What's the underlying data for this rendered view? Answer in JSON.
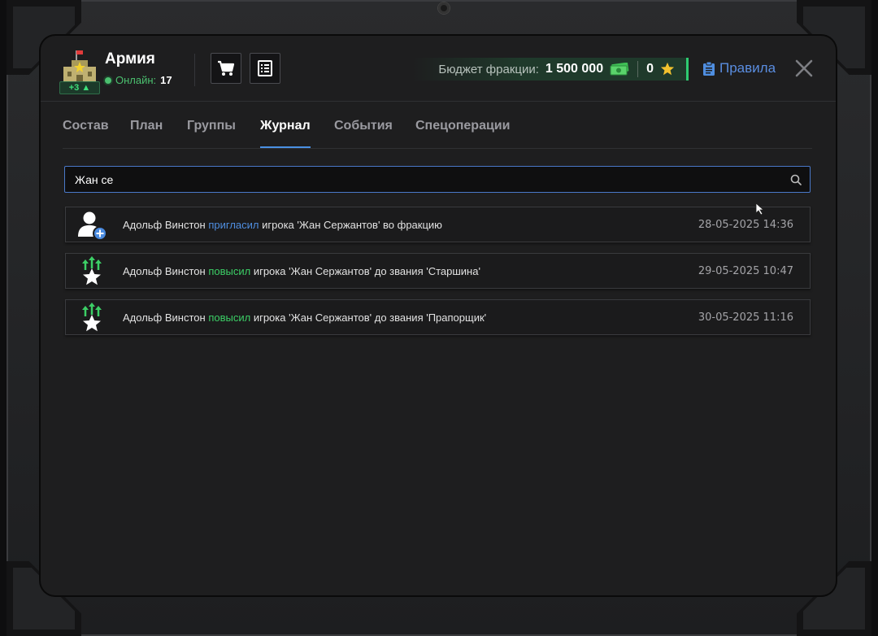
{
  "header": {
    "faction_name": "Армия",
    "faction_badge": "+3",
    "online_label": "Онлайн:",
    "online_count": "17",
    "budget_label": "Бюджет фракции:",
    "budget_value": "1 500 000",
    "stars_value": "0",
    "rules_label": "Правила"
  },
  "icons": {
    "shop": "shopping-cart-icon",
    "ledger": "document-list-icon",
    "money": "cash-icon",
    "star": "star-icon",
    "rules": "clipboard-icon",
    "close": "close-icon",
    "search": "search-icon"
  },
  "tabs": [
    {
      "label": "Состав",
      "active": false
    },
    {
      "label": "План",
      "active": false
    },
    {
      "label": "Группы",
      "active": false
    },
    {
      "label": "Журнал",
      "active": true
    },
    {
      "label": "События",
      "active": false
    },
    {
      "label": "Спецоперации",
      "active": false
    }
  ],
  "search": {
    "value": "Жан се",
    "placeholder": ""
  },
  "log": [
    {
      "icon": "user-add-icon",
      "actor": "Адольф Винстон",
      "action": "пригласил",
      "action_type": "invite",
      "rest": "игрока 'Жан Сержантов' во фракцию",
      "time": "28-05-2025 14:36"
    },
    {
      "icon": "rank-up-icon",
      "actor": "Адольф Винстон",
      "action": "повысил",
      "action_type": "promote",
      "rest": "игрока 'Жан Сержантов' до звания 'Старшина'",
      "time": "29-05-2025 10:47"
    },
    {
      "icon": "rank-up-icon",
      "actor": "Адольф Винстон",
      "action": "повысил",
      "action_type": "promote",
      "rest": "игрока 'Жан Сержантов' до звания 'Прапорщик'",
      "time": "30-05-2025 11:16"
    }
  ],
  "colors": {
    "accent_blue": "#4a90e2",
    "invite_blue": "#4f8ee0",
    "promote_green": "#3ccf66",
    "budget_green": "#2ecc71"
  }
}
